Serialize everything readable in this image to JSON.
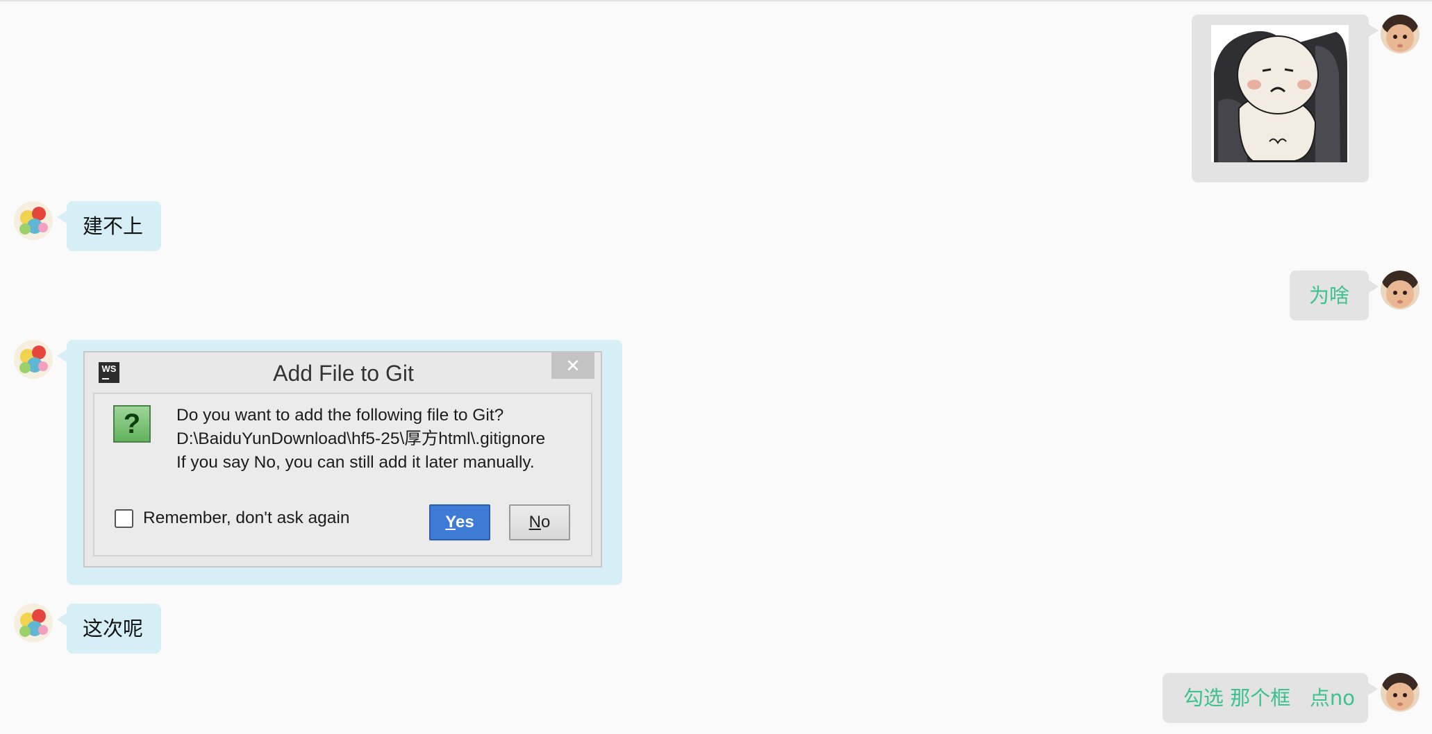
{
  "colors": {
    "page_background": "#fafafa",
    "incoming_bubble": "#d6eef5",
    "outgoing_bubble": "#e3e3e3",
    "outgoing_text": "#3ec28c",
    "incoming_text": "#111111",
    "dialog_yes_button": "#3e7bd6"
  },
  "conversation": {
    "messages": [
      {
        "direction": "outgoing",
        "type": "sticker",
        "avatar": "baby-photo-avatar",
        "sticker": "grumpy-cartoon-in-armchair"
      },
      {
        "direction": "incoming",
        "type": "text",
        "avatar": "balloons-avatar",
        "text": "建不上"
      },
      {
        "direction": "outgoing",
        "type": "text",
        "avatar": "baby-photo-avatar",
        "text": "为啥"
      },
      {
        "direction": "incoming",
        "type": "image",
        "avatar": "balloons-avatar",
        "image": "dialog-screenshot"
      },
      {
        "direction": "incoming",
        "type": "text",
        "avatar": "balloons-avatar",
        "text": "这次呢"
      },
      {
        "direction": "outgoing",
        "type": "text",
        "avatar": "baby-photo-avatar",
        "text": "勾选 那个框   点no"
      }
    ]
  },
  "dialog": {
    "app_logo_text": "WS",
    "title": "Add File to Git",
    "close_glyph": "✕",
    "icon_glyph": "?",
    "lines": [
      "Do you want to add the following file to Git?",
      "D:\\BaiduYunDownload\\hf5-25\\厚方html\\.gitignore",
      "If you say No, you can still add it later manually."
    ],
    "checkbox_label": "Remember, don't ask again",
    "checkbox_checked": false,
    "yes_mnemonic": "Y",
    "yes_rest": "es",
    "no_mnemonic": "N",
    "no_rest": "o"
  }
}
